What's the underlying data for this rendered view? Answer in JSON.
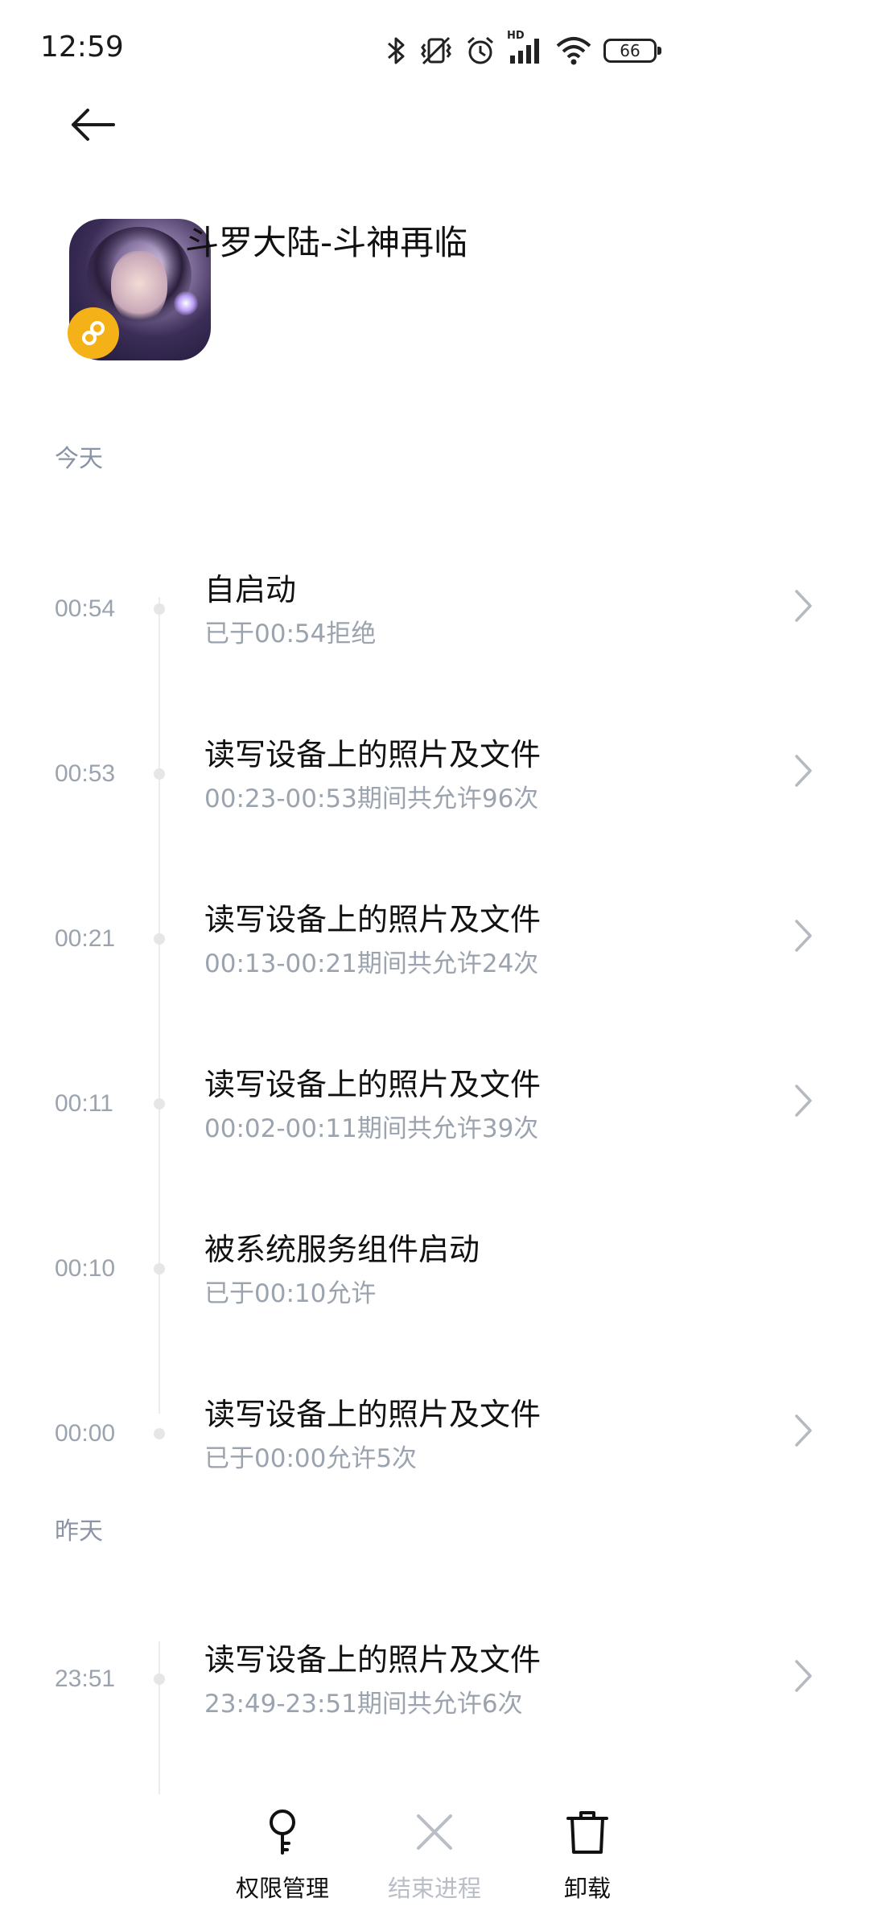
{
  "status_bar": {
    "time": "12:59",
    "battery": "66",
    "network_badge": "HD",
    "icons": [
      "bluetooth-icon",
      "vibrate-off-icon",
      "alarm-icon",
      "signal-icon",
      "wifi-icon",
      "battery-icon"
    ]
  },
  "app": {
    "name": "斗罗大陆-斗神再临"
  },
  "sections": [
    {
      "label": "今天"
    },
    {
      "label": "昨天"
    }
  ],
  "events": [
    {
      "time": "00:54",
      "title": "自启动",
      "subtitle": "已于00:54拒绝",
      "has_chevron": true
    },
    {
      "time": "00:53",
      "title": "读写设备上的照片及文件",
      "subtitle": "00:23-00:53期间共允许96次",
      "has_chevron": true
    },
    {
      "time": "00:21",
      "title": "读写设备上的照片及文件",
      "subtitle": "00:13-00:21期间共允许24次",
      "has_chevron": true
    },
    {
      "time": "00:11",
      "title": "读写设备上的照片及文件",
      "subtitle": "00:02-00:11期间共允许39次",
      "has_chevron": true
    },
    {
      "time": "00:10",
      "title": "被系统服务组件启动",
      "subtitle": "已于00:10允许",
      "has_chevron": false
    },
    {
      "time": "00:00",
      "title": "读写设备上的照片及文件",
      "subtitle": "已于00:00允许5次",
      "has_chevron": true
    },
    {
      "time": "23:51",
      "title": "读写设备上的照片及文件",
      "subtitle": "23:49-23:51期间共允许6次",
      "has_chevron": true
    }
  ],
  "bottom_bar": {
    "permissions_label": "权限管理",
    "end_process_label": "结束进程",
    "uninstall_label": "卸载"
  },
  "colors": {
    "secondary_text": "#9ba3ae",
    "section_label": "#8a94a6",
    "badge": "#f5b118",
    "disabled": "#b9bec6"
  }
}
